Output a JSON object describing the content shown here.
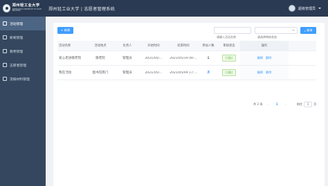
{
  "header": {
    "logo_cn": "郑州轻工业大学",
    "logo_en": "ZHENGZHOU UNIVERSITY OF LIGHT INDUSTRY",
    "title": "郑州轻工业大学 | 志愿者管理系统",
    "user_name": "超级管理员"
  },
  "sidebar": {
    "items": [
      {
        "label": "活动管理",
        "icon": "calendar-icon",
        "active": true
      },
      {
        "label": "新闻管理",
        "icon": "news-icon",
        "active": false
      },
      {
        "label": "教师管理",
        "icon": "teacher-icon",
        "active": false
      },
      {
        "label": "志愿者管理",
        "icon": "volunteer-icon",
        "active": false
      },
      {
        "label": "流报材料管理",
        "icon": "document-icon",
        "active": false
      }
    ]
  },
  "toolbar": {
    "add_label": "+ 新增",
    "search_placeholder": "请输入活动名称",
    "status_placeholder": "请选择审核状态",
    "query_label": "查询"
  },
  "table": {
    "headers": [
      "活动名称",
      "活动地点",
      "负责人",
      "开始时间",
      "结束时间",
      "参加人数",
      "审核状态",
      "操作"
    ],
    "rows": [
      {
        "name": "爱心走进敬老院",
        "place": "敬老院",
        "owner": "管理员",
        "start": "2021/05/...",
        "end": "2021/05/19 00:...",
        "count": "1",
        "status": "已通过",
        "edit": "编辑",
        "delete": "删除"
      },
      {
        "name": "我在活动",
        "place": "图书馆南门",
        "owner": "管理员",
        "start": "2021/05/...",
        "end": "2021/05/09 17:...",
        "count": "3",
        "status": "已通过",
        "edit": "编辑",
        "delete": "删除"
      }
    ]
  },
  "pagination": {
    "total": "共 2 条",
    "current_page": "1",
    "goto_label": "前往",
    "goto_value": "1",
    "page_suffix": "页"
  },
  "colors": {
    "header_bg": "#2a3a52",
    "sidebar_bg": "#34475f",
    "active_bg": "#4d6584",
    "primary": "#409eff",
    "success": "#67c23a"
  }
}
